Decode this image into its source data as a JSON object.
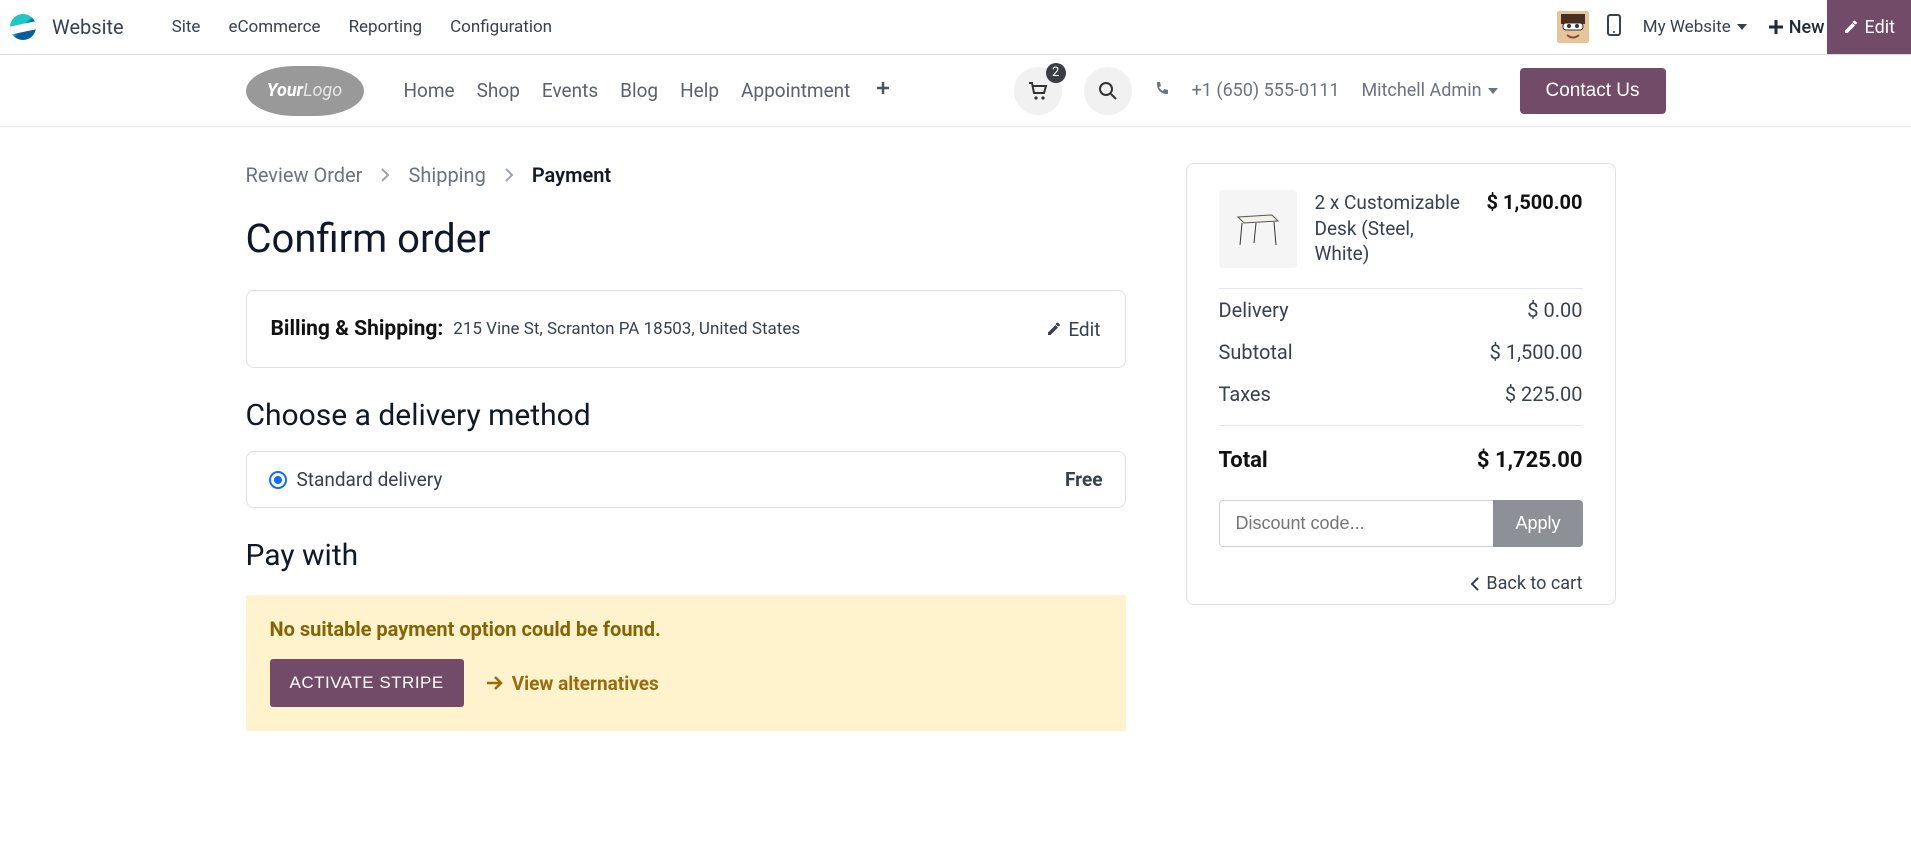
{
  "sysbar": {
    "app_title": "Website",
    "menu": [
      "Site",
      "eCommerce",
      "Reporting",
      "Configuration"
    ],
    "site_name": "My Website",
    "new_label": "New",
    "edit_label": "Edit"
  },
  "sitebar": {
    "logo_text1": "Your",
    "logo_text2": "Logo",
    "nav": [
      "Home",
      "Shop",
      "Events",
      "Blog",
      "Help",
      "Appointment"
    ],
    "cart_count": "2",
    "phone": "+1 (650) 555-0111",
    "user_name": "Mitchell Admin",
    "contact_label": "Contact Us"
  },
  "breadcrumb": {
    "step1": "Review Order",
    "step2": "Shipping",
    "step3": "Payment"
  },
  "headings": {
    "confirm": "Confirm order",
    "delivery": "Choose a delivery method",
    "pay": "Pay with"
  },
  "billing": {
    "label": "Billing & Shipping:",
    "address": "215 Vine St, Scranton PA 18503, United States",
    "edit_label": "Edit"
  },
  "delivery": {
    "option_label": "Standard delivery",
    "option_price": "Free"
  },
  "payment_warning": {
    "message": "No suitable payment option could be found.",
    "activate_label": "ACTIVATE STRIPE",
    "alt_label": "View alternatives"
  },
  "order": {
    "qty_prefix": "2 x",
    "product_name": "Customizable Desk (Steel, White)",
    "line_amount": "$ 1,500.00",
    "rows": {
      "delivery_label": "Delivery",
      "delivery_value": "$ 0.00",
      "subtotal_label": "Subtotal",
      "subtotal_value": "$ 1,500.00",
      "taxes_label": "Taxes",
      "taxes_value": "$ 225.00",
      "total_label": "Total",
      "total_value": "$ 1,725.00"
    },
    "promo_placeholder": "Discount code...",
    "apply_label": "Apply",
    "back_label": "Back to cart"
  }
}
